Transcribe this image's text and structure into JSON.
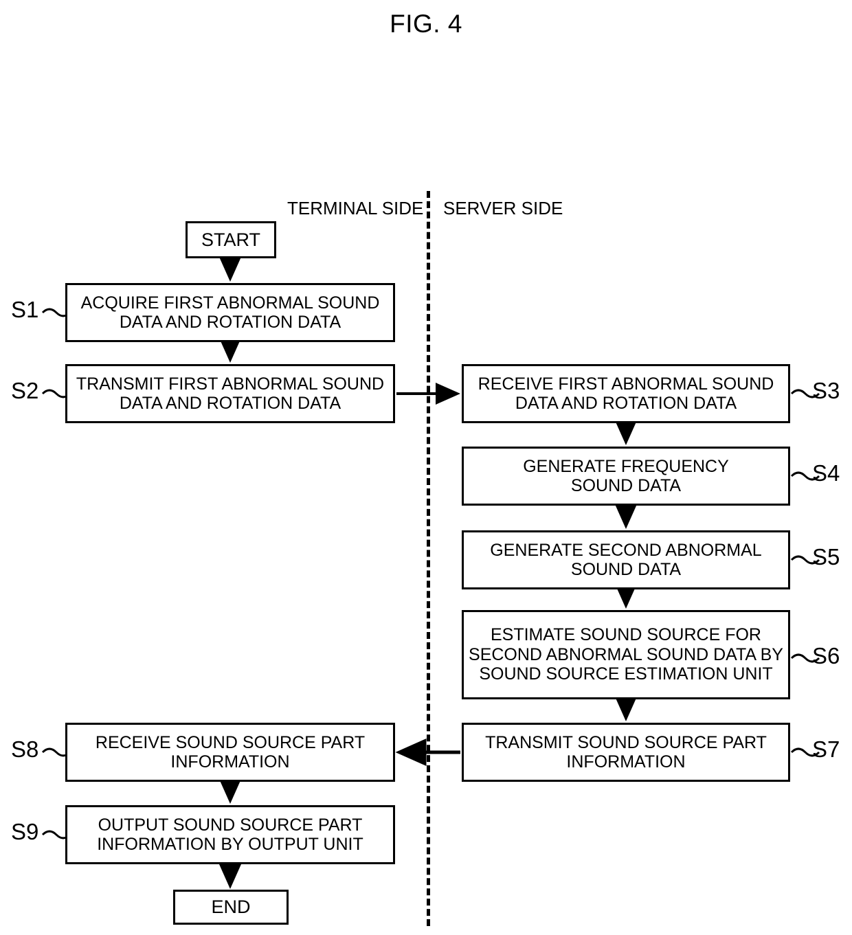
{
  "figure": {
    "title": "FIG. 4"
  },
  "lanes": {
    "terminal_label": "TERMINAL SIDE",
    "server_label": "SERVER SIDE"
  },
  "terminal_nodes": [
    {
      "id": "start",
      "tag": "",
      "lines": [
        "START"
      ]
    },
    {
      "id": "s1",
      "tag": "S1",
      "lines": [
        "ACQUIRE FIRST ABNORMAL SOUND",
        "DATA AND ROTATION DATA"
      ]
    },
    {
      "id": "s2",
      "tag": "S2",
      "lines": [
        "TRANSMIT FIRST ABNORMAL SOUND",
        "DATA AND ROTATION DATA"
      ]
    },
    {
      "id": "s8",
      "tag": "S8",
      "lines": [
        "RECEIVE SOUND SOURCE PART",
        "INFORMATION"
      ]
    },
    {
      "id": "s9",
      "tag": "S9",
      "lines": [
        "OUTPUT SOUND SOURCE PART",
        "INFORMATION BY OUTPUT UNIT"
      ]
    },
    {
      "id": "end",
      "tag": "",
      "lines": [
        "END"
      ]
    }
  ],
  "server_nodes": [
    {
      "id": "s3",
      "tag": "S3",
      "lines": [
        "RECEIVE FIRST ABNORMAL SOUND",
        "DATA AND ROTATION DATA"
      ]
    },
    {
      "id": "s4",
      "tag": "S4",
      "lines": [
        "GENERATE FREQUENCY",
        "SOUND DATA"
      ]
    },
    {
      "id": "s5",
      "tag": "S5",
      "lines": [
        "GENERATE SECOND ABNORMAL",
        "SOUND DATA"
      ]
    },
    {
      "id": "s6",
      "tag": "S6",
      "lines": [
        "ESTIMATE SOUND SOURCE FOR",
        "SECOND ABNORMAL SOUND DATA BY",
        "SOUND SOURCE ESTIMATION UNIT"
      ]
    },
    {
      "id": "s7",
      "tag": "S7",
      "lines": [
        "TRANSMIT SOUND SOURCE PART",
        "INFORMATION"
      ]
    }
  ],
  "node_text": {
    "start": "START",
    "end": "END",
    "s1_l1": "ACQUIRE FIRST ABNORMAL SOUND",
    "s1_l2": "DATA AND ROTATION DATA",
    "s2_l1": "TRANSMIT FIRST ABNORMAL SOUND",
    "s2_l2": "DATA AND ROTATION DATA",
    "s3_l1": "RECEIVE FIRST ABNORMAL SOUND",
    "s3_l2": "DATA AND ROTATION DATA",
    "s4_l1": "GENERATE FREQUENCY",
    "s4_l2": "SOUND DATA",
    "s5_l1": "GENERATE SECOND ABNORMAL",
    "s5_l2": "SOUND DATA",
    "s6_l1": "ESTIMATE SOUND SOURCE FOR",
    "s6_l2": "SECOND ABNORMAL SOUND DATA BY",
    "s6_l3": "SOUND SOURCE ESTIMATION UNIT",
    "s7_l1": "TRANSMIT SOUND SOURCE PART",
    "s7_l2": "INFORMATION",
    "s8_l1": "RECEIVE SOUND SOURCE PART",
    "s8_l2": "INFORMATION",
    "s9_l1": "OUTPUT SOUND SOURCE PART",
    "s9_l2": "INFORMATION BY OUTPUT UNIT"
  },
  "tags": {
    "s1": "S1",
    "s2": "S2",
    "s3": "S3",
    "s4": "S4",
    "s5": "S5",
    "s6": "S6",
    "s7": "S7",
    "s8": "S8",
    "s9": "S9"
  },
  "colors": {
    "stroke": "#000000",
    "background": "#ffffff"
  }
}
